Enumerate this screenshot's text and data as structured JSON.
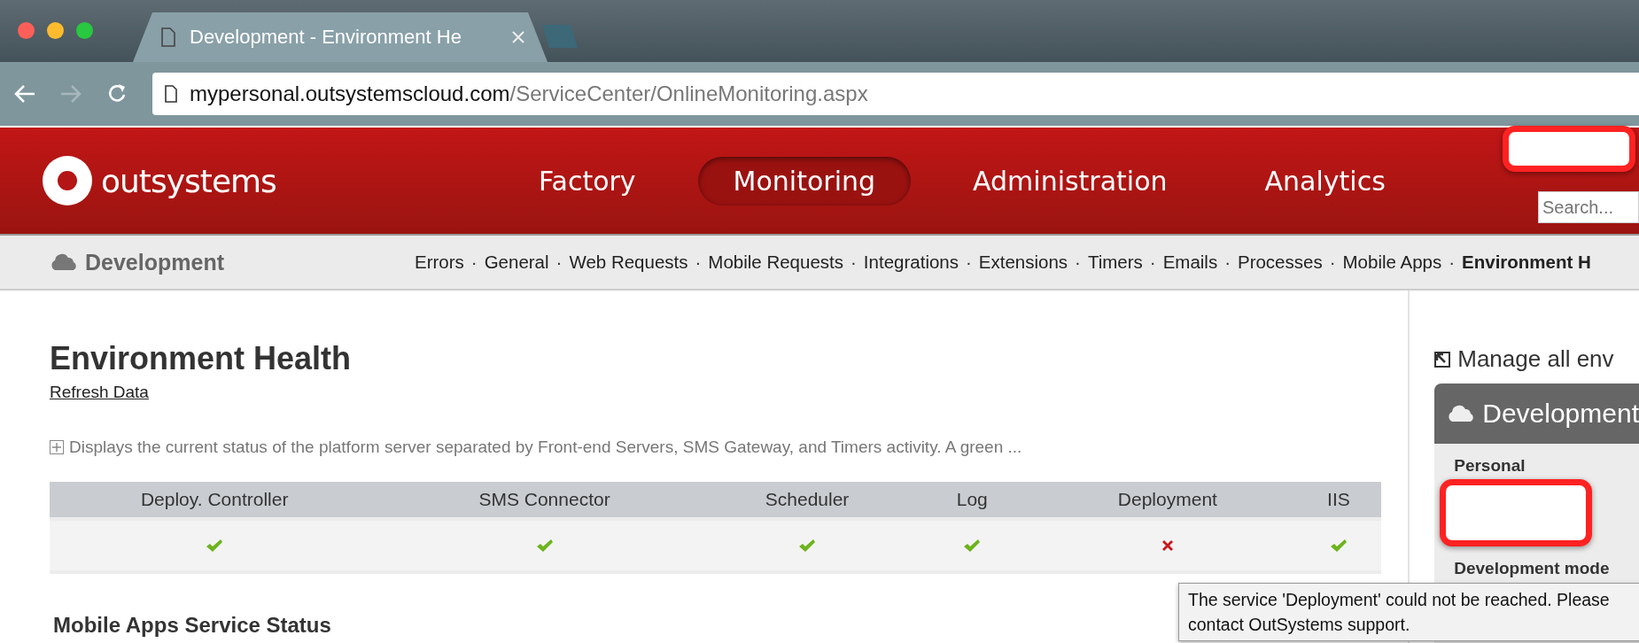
{
  "browser": {
    "tabs": [
      {
        "title": "Development - Environment He",
        "selected": true
      },
      {
        "selected": false
      }
    ],
    "url": {
      "host": "mypersonal.outsystemscloud.com",
      "path": "/ServiceCenter/OnlineMonitoring.aspx"
    }
  },
  "header": {
    "logo_text": "outsystems",
    "nav": [
      {
        "label": "Factory",
        "selected": false
      },
      {
        "label": "Monitoring",
        "selected": true
      },
      {
        "label": "Administration",
        "selected": false
      },
      {
        "label": "Analytics",
        "selected": false
      }
    ],
    "search": {
      "placeholder": "Search..."
    }
  },
  "subnav": {
    "environment": "Development",
    "links": [
      {
        "label": "Errors",
        "selected": false
      },
      {
        "separator": "·",
        "label": "General",
        "selected": false
      },
      {
        "separator": "·",
        "label": "Web Requests",
        "selected": false
      },
      {
        "separator": "·",
        "label": "Mobile Requests",
        "selected": false
      },
      {
        "separator": "·",
        "label": "Integrations",
        "selected": false
      },
      {
        "separator": "·",
        "label": "Extensions",
        "selected": false
      },
      {
        "separator": "·",
        "label": "Timers",
        "selected": false
      },
      {
        "separator": "·",
        "label": "Emails",
        "selected": false
      },
      {
        "separator": "·",
        "label": "Processes",
        "selected": false
      },
      {
        "separator": "·",
        "label": "Mobile Apps",
        "selected": false
      },
      {
        "separator": "·",
        "label": "Environment H",
        "selected": true
      }
    ]
  },
  "main": {
    "title": "Environment Health",
    "refresh_link": "Refresh Data",
    "description": "Displays the current status of the platform server separated by Front-end Servers, SMS Gateway, and Timers activity. A green ...",
    "services": [
      {
        "label": "Deploy. Controller",
        "healthy": true
      },
      {
        "label": "SMS Connector",
        "healthy": true
      },
      {
        "label": "Scheduler",
        "healthy": true
      },
      {
        "label": "Log",
        "healthy": true
      },
      {
        "label": "Deployment",
        "healthy": false
      },
      {
        "label": "IIS",
        "healthy": true
      }
    ],
    "section_title": "Mobile Apps Service Status",
    "tooltip": "The service 'Deployment' could not be reached. Please contact OutSystems support."
  },
  "sidebar": {
    "manage_link": "Manage all env",
    "panel_title": "Development",
    "fields": [
      "Personal",
      "Development mode"
    ]
  }
}
